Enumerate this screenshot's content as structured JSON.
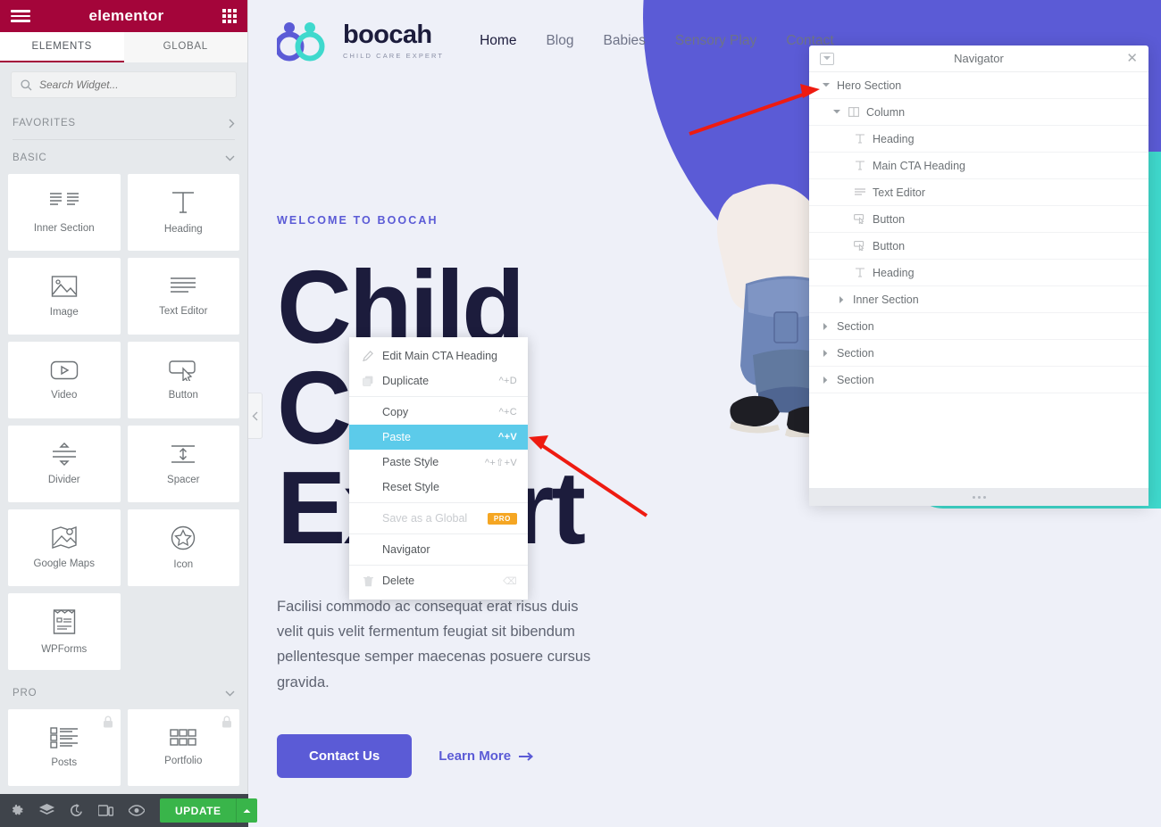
{
  "panel": {
    "brand": "elementor",
    "hamburger_icon": "hamburger-icon",
    "grid_icon": "apps-grid-icon",
    "tabs": [
      {
        "label": "ELEMENTS",
        "active": true
      },
      {
        "label": "GLOBAL",
        "active": false
      }
    ],
    "search": {
      "placeholder": "Search Widget...",
      "value": "",
      "icon": "search-icon"
    },
    "categories": [
      {
        "name": "FAVORITES",
        "chevron": "chevron-right-icon",
        "expanded": false
      },
      {
        "name": "BASIC",
        "chevron": "chevron-down-icon",
        "expanded": true
      },
      {
        "name": "PRO",
        "chevron": "chevron-down-icon",
        "expanded": true
      }
    ],
    "basic_widgets": [
      {
        "label": "Inner Section",
        "icon": "inner-section-icon",
        "locked": false
      },
      {
        "label": "Heading",
        "icon": "heading-icon",
        "locked": false
      },
      {
        "label": "Image",
        "icon": "image-icon",
        "locked": false
      },
      {
        "label": "Text Editor",
        "icon": "text-editor-icon",
        "locked": false
      },
      {
        "label": "Video",
        "icon": "video-icon",
        "locked": false
      },
      {
        "label": "Button",
        "icon": "button-icon",
        "locked": false
      },
      {
        "label": "Divider",
        "icon": "divider-icon",
        "locked": false
      },
      {
        "label": "Spacer",
        "icon": "spacer-icon",
        "locked": false
      },
      {
        "label": "Google Maps",
        "icon": "google-maps-icon",
        "locked": false
      },
      {
        "label": "Icon",
        "icon": "star-icon",
        "locked": false
      },
      {
        "label": "WPForms",
        "icon": "wpforms-icon",
        "locked": false
      }
    ],
    "pro_widgets": [
      {
        "label": "Posts",
        "icon": "posts-icon",
        "locked": true
      },
      {
        "label": "Portfolio",
        "icon": "portfolio-icon",
        "locked": true
      }
    ]
  },
  "bottom_bar": {
    "icons": [
      {
        "name": "settings-gear-icon"
      },
      {
        "name": "layers-navigator-icon"
      },
      {
        "name": "history-icon"
      },
      {
        "name": "responsive-mode-icon"
      },
      {
        "name": "preview-eye-icon"
      }
    ],
    "update_label": "UPDATE",
    "update_arrow_icon": "chevron-up-icon",
    "update_color": "#39b54a"
  },
  "collapse_tab": {
    "icon": "chevron-left-icon"
  },
  "site": {
    "logo": {
      "name": "boocah",
      "tagline": "CHILD CARE EXPERT"
    },
    "nav": [
      {
        "label": "Home",
        "active": true
      },
      {
        "label": "Blog",
        "active": false
      },
      {
        "label": "Babies",
        "active": false
      },
      {
        "label": "Sensory Play",
        "active": false
      },
      {
        "label": "Contact",
        "active": false
      }
    ],
    "hero": {
      "eyebrow": "WELCOME TO BOOCAH",
      "title": "Child Care Expert",
      "body": "Facilisi commodo ac consequat erat risus duis velit quis velit fermentum feugiat sit bibendum pellentesque semper maecenas posuere cursus gravida.",
      "primary_button": "Contact Us",
      "secondary_button": "Learn More",
      "secondary_icon": "arrow-right-icon"
    },
    "colors": {
      "accent": "#5b5bd6",
      "teal": "#3fd9cd",
      "dark": "#1c1c3c",
      "background": "#eef0f8"
    }
  },
  "context_menu": {
    "groups": [
      {
        "items": [
          {
            "label": "Edit Main CTA Heading",
            "shortcut": "",
            "icon": "pencil-icon",
            "state": "normal"
          },
          {
            "label": "Duplicate",
            "shortcut": "^+D",
            "icon": "duplicate-icon",
            "state": "normal"
          }
        ]
      },
      {
        "items": [
          {
            "label": "Copy",
            "shortcut": "^+C",
            "icon": "",
            "state": "normal"
          },
          {
            "label": "Paste",
            "shortcut": "^+V",
            "icon": "",
            "state": "selected"
          },
          {
            "label": "Paste Style",
            "shortcut": "^+⇧+V",
            "icon": "",
            "state": "normal"
          },
          {
            "label": "Reset Style",
            "shortcut": "",
            "icon": "",
            "state": "normal"
          }
        ]
      },
      {
        "items": [
          {
            "label": "Save as a Global",
            "shortcut": "",
            "icon": "",
            "state": "disabled",
            "badge": "PRO"
          }
        ]
      },
      {
        "items": [
          {
            "label": "Navigator",
            "shortcut": "",
            "icon": "",
            "state": "normal"
          }
        ]
      },
      {
        "items": [
          {
            "label": "Delete",
            "shortcut": "⌫",
            "icon": "trash-icon",
            "state": "normal"
          }
        ]
      }
    ],
    "highlight_color": "#5ccbea",
    "pro_badge_color": "#f5a623"
  },
  "navigator": {
    "title": "Navigator",
    "collapse_icon": "collapse-all-icon",
    "close_icon": "close-icon",
    "resize_handle_icon": "resize-dots-icon",
    "items": [
      {
        "label": "Hero Section",
        "depth": 0,
        "toggle": "expanded",
        "icon": ""
      },
      {
        "label": "Column",
        "depth": 1,
        "toggle": "expanded",
        "icon": "column-icon"
      },
      {
        "label": "Heading",
        "depth": 2,
        "toggle": "none",
        "icon": "heading-icon"
      },
      {
        "label": "Main CTA Heading",
        "depth": 2,
        "toggle": "none",
        "icon": "heading-icon"
      },
      {
        "label": "Text Editor",
        "depth": 2,
        "toggle": "none",
        "icon": "text-editor-icon"
      },
      {
        "label": "Button",
        "depth": 2,
        "toggle": "none",
        "icon": "button-icon"
      },
      {
        "label": "Button",
        "depth": 2,
        "toggle": "none",
        "icon": "button-icon"
      },
      {
        "label": "Heading",
        "depth": 2,
        "toggle": "none",
        "icon": "heading-icon"
      },
      {
        "label": "Inner Section",
        "depth": 1,
        "toggle": "collapsed",
        "icon": ""
      },
      {
        "label": "Section",
        "depth": 0,
        "toggle": "collapsed",
        "icon": ""
      },
      {
        "label": "Section",
        "depth": 0,
        "toggle": "collapsed",
        "icon": ""
      },
      {
        "label": "Section",
        "depth": 0,
        "toggle": "collapsed",
        "icon": ""
      }
    ]
  },
  "annotations": {
    "arrow_color": "#ee1b11",
    "arrows": [
      {
        "name": "arrow-to-hero-section",
        "from": [
          772,
          150
        ],
        "to": [
          916,
          102
        ]
      },
      {
        "name": "arrow-to-paste-item",
        "from": [
          724,
          578
        ],
        "to": [
          594,
          494
        ]
      }
    ]
  }
}
